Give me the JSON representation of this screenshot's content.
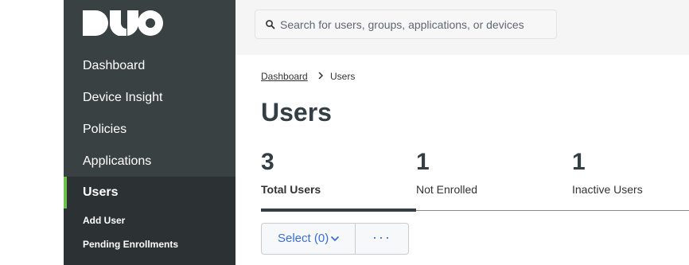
{
  "brand": {
    "logo_name": "duo-logo",
    "accent": "#6dc04b"
  },
  "search": {
    "placeholder": "Search for users, groups, applications, or devices",
    "icon": "search-icon"
  },
  "sidebar": {
    "items": [
      {
        "label": "Dashboard"
      },
      {
        "label": "Device Insight"
      },
      {
        "label": "Policies"
      },
      {
        "label": "Applications"
      },
      {
        "label": "Users",
        "active": true
      }
    ],
    "subitems": [
      {
        "label": "Add User"
      },
      {
        "label": "Pending Enrollments"
      }
    ]
  },
  "breadcrumb": {
    "parent": "Dashboard",
    "current": "Users"
  },
  "page": {
    "title": "Users"
  },
  "stats": [
    {
      "value": "3",
      "label": "Total Users",
      "active": true
    },
    {
      "value": "1",
      "label": "Not Enrolled"
    },
    {
      "value": "1",
      "label": "Inactive Users"
    }
  ],
  "toolbar": {
    "select_label": "Select (0)",
    "more_label": "···"
  }
}
